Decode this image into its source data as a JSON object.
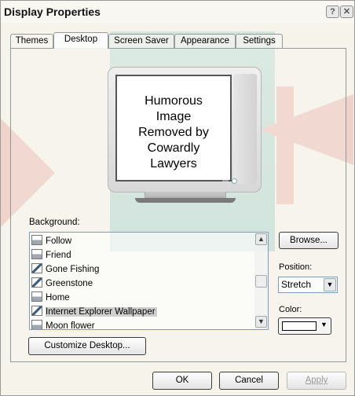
{
  "window": {
    "title": "Display Properties",
    "help_glyph": "?",
    "close_glyph": "✕"
  },
  "tabs": [
    "Themes",
    "Desktop",
    "Screen Saver",
    "Appearance",
    "Settings"
  ],
  "active_tab": "Desktop",
  "preview": {
    "screen_text": [
      "Humorous",
      "Image",
      "Removed by",
      "Cowardly",
      "Lawyers"
    ]
  },
  "background": {
    "label": "Background:",
    "items": [
      {
        "label": "Follow",
        "icon": "bitmap-file-icon"
      },
      {
        "label": "Friend",
        "icon": "bitmap-file-icon"
      },
      {
        "label": "Gone Fishing",
        "icon": "wallpaper-file-icon"
      },
      {
        "label": "Greenstone",
        "icon": "wallpaper-file-icon"
      },
      {
        "label": "Home",
        "icon": "bitmap-file-icon"
      },
      {
        "label": "Internet Explorer Wallpaper",
        "icon": "wallpaper-file-icon"
      },
      {
        "label": "Moon flower",
        "icon": "bitmap-file-icon"
      }
    ],
    "selected_index": 5
  },
  "browse_label": "Browse...",
  "position": {
    "label": "Position:",
    "value": "Stretch"
  },
  "color": {
    "label": "Color:",
    "value": "#ffffff"
  },
  "customize_label": "Customize Desktop...",
  "footer": {
    "ok": "OK",
    "cancel": "Cancel",
    "apply": "Apply"
  }
}
